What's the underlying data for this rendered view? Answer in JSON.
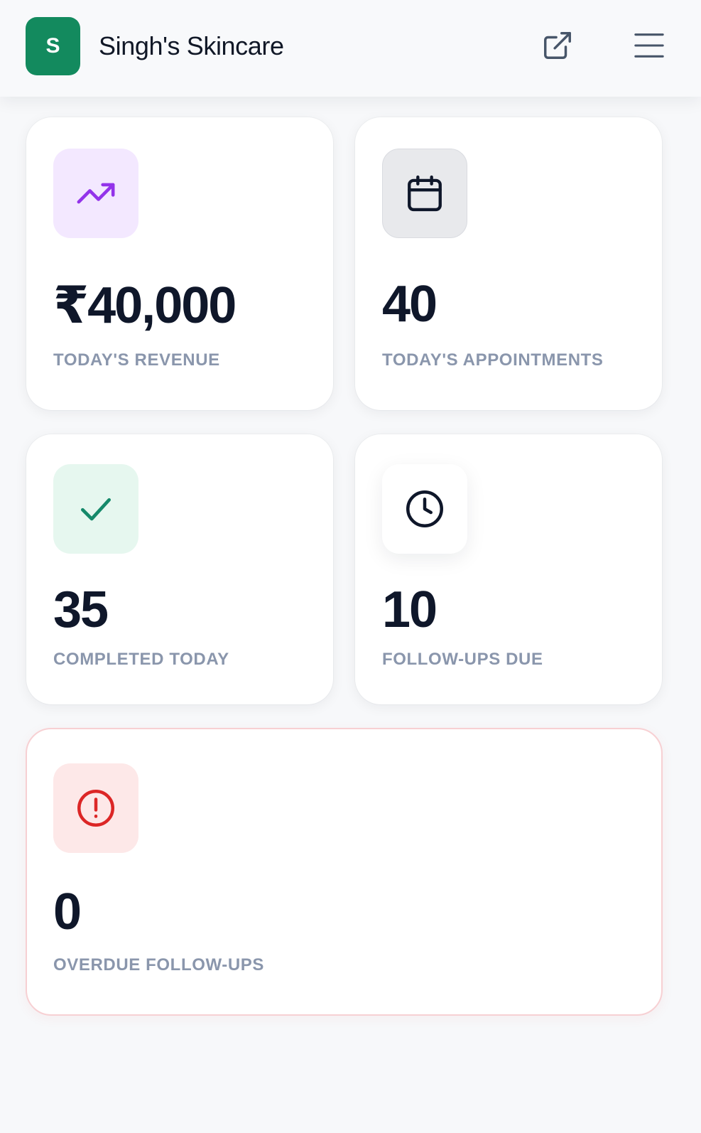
{
  "header": {
    "logo_letter": "S",
    "title": "Singh's Skincare",
    "external_icon": "external-link-icon",
    "menu_icon": "hamburger-menu-icon"
  },
  "stats": [
    {
      "value": "₹40,000",
      "label": "TODAY'S REVENUE",
      "icon": "trending-up-icon",
      "icon_color": "#9333ea",
      "icon_bg": "#f3e8ff"
    },
    {
      "value": "40",
      "label": "TODAY'S APPOINTMENTS",
      "icon": "calendar-icon",
      "icon_color": "#0f172a",
      "icon_bg": "#e8e9ec"
    },
    {
      "value": "35",
      "label": "COMPLETED TODAY",
      "icon": "check-icon",
      "icon_color": "#15896a",
      "icon_bg": "#e6f7ef"
    },
    {
      "value": "10",
      "label": "FOLLOW-UPS DUE",
      "icon": "clock-icon",
      "icon_color": "#0f172a",
      "icon_bg": "#ffffff"
    },
    {
      "value": "0",
      "label": "OVERDUE FOLLOW-UPS",
      "icon": "alert-circle-icon",
      "icon_color": "#dc2626",
      "icon_bg": "#fde8e8"
    }
  ],
  "colors": {
    "brand": "#138a5e",
    "danger_border": "#f7d0d3",
    "label": "#8a96ac",
    "value": "#0f172a"
  }
}
